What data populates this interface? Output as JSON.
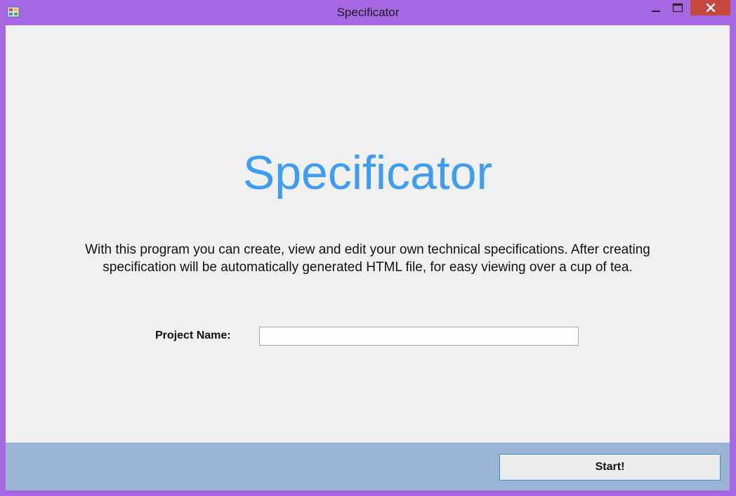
{
  "window": {
    "title": "Specificator",
    "icons": {
      "app": "app-icon",
      "minimize": "minimize-icon",
      "maximize": "maximize-icon",
      "close": "close-icon"
    },
    "colors": {
      "frame": "#a667e3",
      "close_button": "#c7463e"
    }
  },
  "main": {
    "heading": "Specificator",
    "heading_color": "#3d9cf4",
    "description": "With this program you can create, view and edit your own technical specifications. After creating specification will be automatically generated HTML file, for easy viewing over a cup of tea.",
    "project_name_label": "Project Name:",
    "project_name_value": ""
  },
  "footer": {
    "start_label": "Start!",
    "background": "#9ab4d3"
  }
}
